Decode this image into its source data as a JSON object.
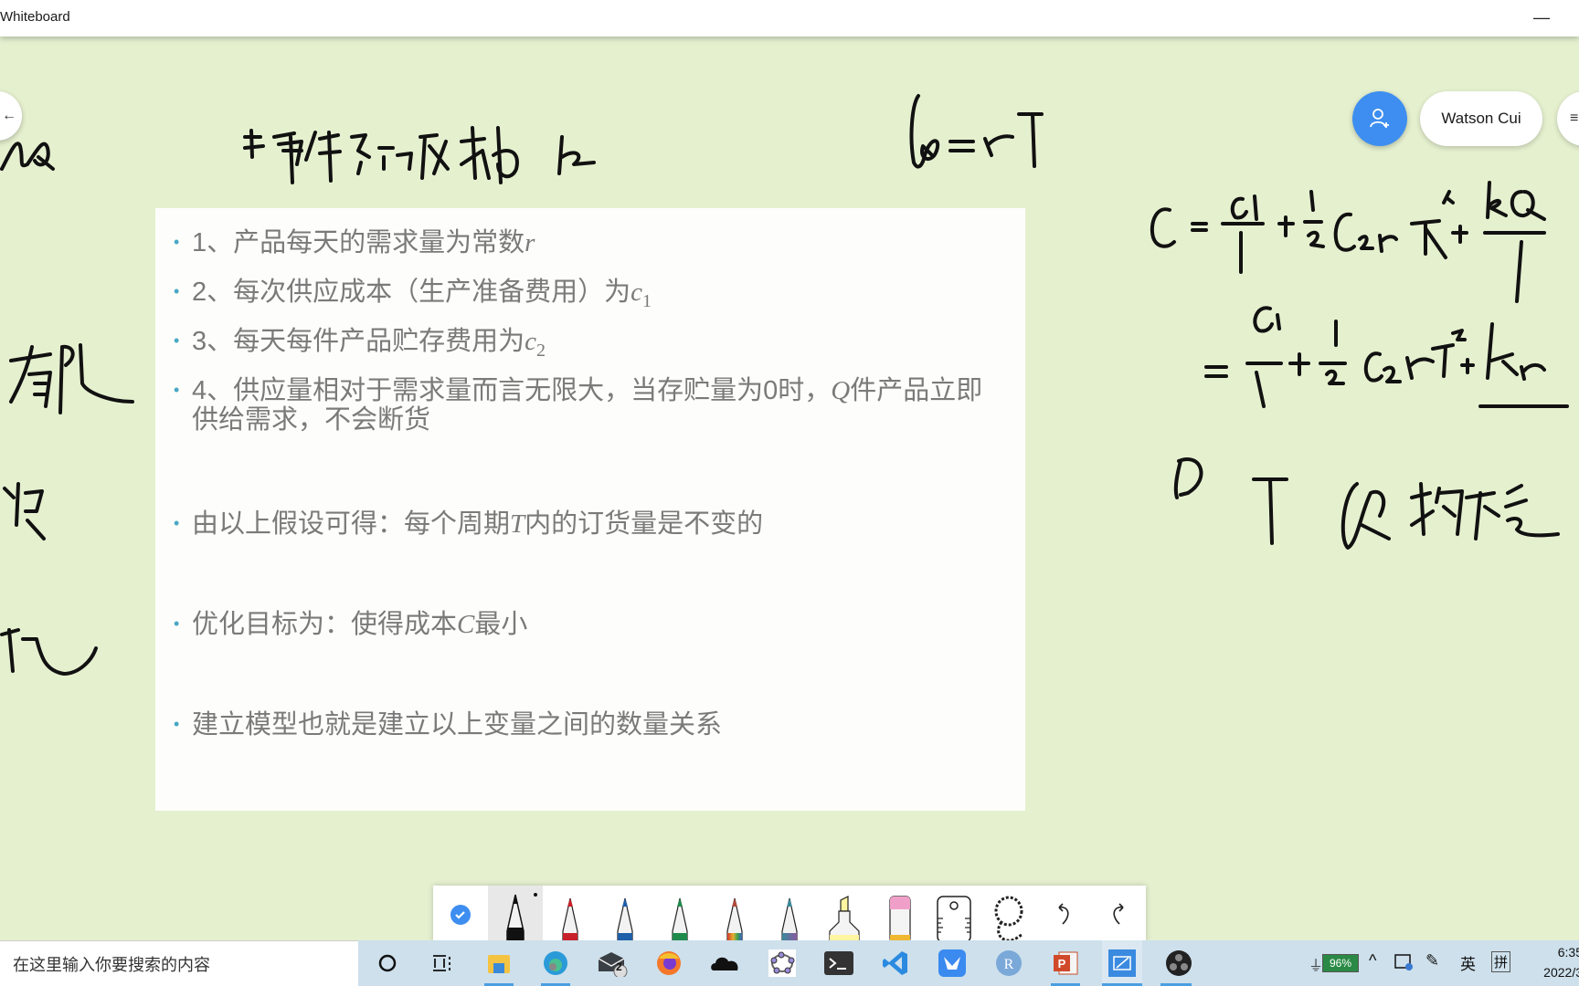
{
  "window": {
    "title": "Whiteboard",
    "minimize_glyph": "—"
  },
  "header": {
    "user_name": "Watson Cui",
    "invite_icon": "add-person-icon",
    "menu_icon": "hamburger-icon",
    "nav_left_glyph": "←"
  },
  "slide": {
    "items": [
      {
        "text": "1、产品每天的需求量为常数",
        "math": "r",
        "sub": ""
      },
      {
        "text": "2、每次供应成本（生产准备费用）为",
        "math": "c",
        "sub": "1"
      },
      {
        "text": "3、每天每件产品贮存费用为",
        "math": "c",
        "sub": "2"
      },
      {
        "text": "4、供应量相对于需求量而言无限大，当存贮量为0时，",
        "math": "Q",
        "after": "件产品立即供给需求，不会断货"
      },
      {
        "text": "由以上假设可得：每个周期",
        "math": "T",
        "after": "内的订货量是不变的"
      },
      {
        "text": "优化目标为：使得成本",
        "math": "C",
        "after": "最小"
      },
      {
        "text": "建立模型也就是建立以上变量之间的数量关系"
      }
    ],
    "bullet": "•"
  },
  "handwriting": {
    "top_note": "每件产品成本为 k",
    "q_formula": "Q = rT",
    "cost_formula_line1": "C = c1/T + ½ c2 r T + kQ/T",
    "cost_formula_line2": "= c1/T + ½ c2 r T + kr",
    "constants_note": "D T Q 均不变",
    "left_notes": [
      "有限",
      "货",
      "极"
    ]
  },
  "pen_toolbar": {
    "tools": [
      {
        "name": "select",
        "icon": "check-circle-icon"
      },
      {
        "name": "black-pen",
        "color": "#111111",
        "selected": true
      },
      {
        "name": "red-pen",
        "color": "#c8202a"
      },
      {
        "name": "blue-pen",
        "color": "#1d5fa8"
      },
      {
        "name": "green-pen",
        "color": "#1f8a4c"
      },
      {
        "name": "rainbow-pen",
        "color": "#c84a3a"
      },
      {
        "name": "galaxy-pen",
        "color": "#3a8a9a"
      },
      {
        "name": "highlighter",
        "color": "#fff5a0"
      },
      {
        "name": "eraser",
        "color": "#f0a0c8"
      },
      {
        "name": "ruler",
        "icon": "ruler-icon"
      },
      {
        "name": "lasso",
        "icon": "lasso-icon"
      },
      {
        "name": "undo",
        "icon": "undo-icon"
      },
      {
        "name": "redo",
        "icon": "redo-icon"
      }
    ]
  },
  "taskbar": {
    "search_placeholder": "在这里输入你要搜索的内容",
    "apps": [
      "cortana-icon",
      "task-view-icon",
      "file-explorer-icon",
      "edge-icon",
      "mail-icon",
      "firefox-icon",
      "onedrive-icon",
      "geogebra-icon",
      "terminal-icon",
      "vscode-icon",
      "feishu-icon",
      "r-icon",
      "powerpoint-icon",
      "whiteboard-icon",
      "obs-icon"
    ],
    "mail_badge": "2",
    "battery": "96%",
    "ime_lang": "英",
    "ime_mode": "拼",
    "time": "6:35",
    "date": "2022/3"
  }
}
